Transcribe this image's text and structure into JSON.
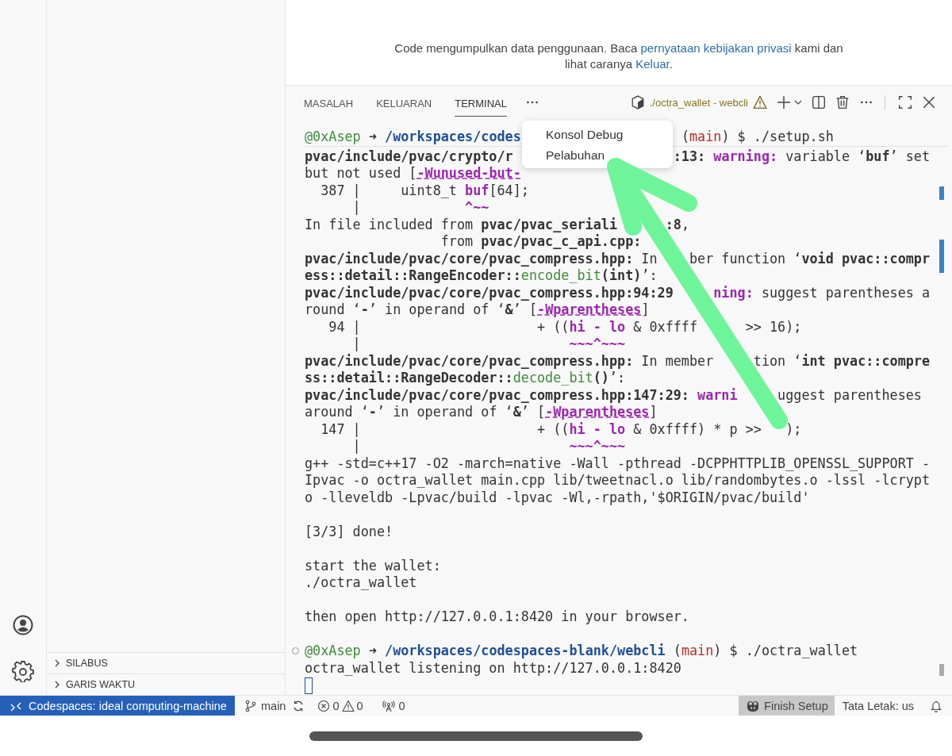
{
  "notice": {
    "before": "Code mengumpulkan data penggunaan. Baca",
    "link": "pernyataan kebijakan privasi",
    "middle": "kami dan lihat caranya",
    "link2": "Keluar",
    "after": "."
  },
  "sidebar": {
    "sections": [
      {
        "label": "SILABUS",
        "expanded": false
      },
      {
        "label": "GARIS WAKTU",
        "expanded": false
      }
    ]
  },
  "panel": {
    "tabs": [
      {
        "label": "MASALAH",
        "selected": false
      },
      {
        "label": "KELUARAN",
        "selected": false
      },
      {
        "label": "TERMINAL",
        "selected": true
      }
    ],
    "terminal_name": "./octra_wallet - webcli",
    "menu": [
      "Konsol Debug",
      "Pelabuhan"
    ],
    "lines": [
      {
        "kind": "text",
        "segments": [
          {
            "text": "@0xAsep",
            "kind": "green"
          },
          {
            "text": " ➜ ",
            "kind": "bold"
          },
          {
            "text": "/workspaces/codes",
            "kind": "blue"
          },
          {
            "text": "(",
            "kind": "plain"
          },
          {
            "text": "main",
            "kind": "red"
          },
          {
            "text": ") $ ./setup.sh",
            "kind": "plain"
          }
        ]
      },
      {
        "kind": "text",
        "segments": [
          {
            "text": "pvac/include/pvac/crypto/r",
            "kind": "bold"
          },
          {
            "text": ":13:",
            "kind": "bold"
          },
          {
            "text": " warning:",
            "kind": "purple"
          },
          {
            "text": " variable ‘",
            "kind": "plain"
          },
          {
            "text": "buf",
            "kind": "bold"
          },
          {
            "text": "’ set",
            "kind": "plain"
          }
        ]
      },
      {
        "kind": "text",
        "segments": [
          {
            "text": "but not used [",
            "kind": "plain"
          },
          {
            "text": "-Wunused-but-",
            "kind": "flag"
          }
        ]
      },
      {
        "kind": "text",
        "segments": [
          {
            "text": "  387 |     uint8_t ",
            "kind": "plain"
          },
          {
            "text": "buf",
            "kind": "purple"
          },
          {
            "text": "[64];",
            "kind": "plain"
          }
        ]
      },
      {
        "kind": "text",
        "segments": [
          {
            "text": "      |             ",
            "kind": "plain"
          },
          {
            "text": "^~~",
            "kind": "purple"
          }
        ]
      },
      {
        "kind": "text",
        "segments": [
          {
            "text": "In file included from ",
            "kind": "plain"
          },
          {
            "text": "pvac/pvac_seriali",
            "kind": "bold"
          },
          {
            "text": ":8",
            "kind": "bold"
          },
          {
            "text": ",",
            "kind": "plain"
          }
        ]
      },
      {
        "kind": "text",
        "segments": [
          {
            "text": "                 from ",
            "kind": "plain"
          },
          {
            "text": "pvac/pvac_c_api.cpp:",
            "kind": "bold"
          }
        ]
      },
      {
        "kind": "text",
        "segments": [
          {
            "text": "pvac/include/pvac/core/pvac_compress.hpp:",
            "kind": "bold"
          },
          {
            "text": " In",
            "kind": "plain"
          },
          {
            "text": "ber function ‘",
            "kind": "plain"
          },
          {
            "text": "void pvac::compr",
            "kind": "bold"
          }
        ]
      },
      {
        "kind": "text",
        "segments": [
          {
            "text": "ess::detail::RangeEncoder::",
            "kind": "bold"
          },
          {
            "text": "encode_bit",
            "kind": "green"
          },
          {
            "text": "(int)",
            "kind": "bold"
          },
          {
            "text": "’:",
            "kind": "plain"
          }
        ]
      },
      {
        "kind": "text",
        "segments": [
          {
            "text": "pvac/include/pvac/core/pvac_compress.hpp:94:29",
            "kind": "bold"
          },
          {
            "text": "ning:",
            "kind": "purple"
          },
          {
            "text": " suggest parentheses a",
            "kind": "plain"
          }
        ]
      },
      {
        "kind": "text",
        "segments": [
          {
            "text": "round ‘",
            "kind": "plain"
          },
          {
            "text": "-",
            "kind": "bold"
          },
          {
            "text": "’ in operand of ‘",
            "kind": "plain"
          },
          {
            "text": "&",
            "kind": "bold"
          },
          {
            "text": "’ [",
            "kind": "plain"
          },
          {
            "text": "-Wparentheses",
            "kind": "flag"
          },
          {
            "text": "]",
            "kind": "plain"
          }
        ]
      },
      {
        "kind": "text",
        "segments": [
          {
            "text": "   94 |                      + ((",
            "kind": "plain"
          },
          {
            "text": "hi - lo",
            "kind": "purple"
          },
          {
            "text": " & 0xffff",
            "kind": "plain"
          },
          {
            "text": " >> 16);",
            "kind": "plain"
          }
        ]
      },
      {
        "kind": "text",
        "segments": [
          {
            "text": "      |                          ",
            "kind": "plain"
          },
          {
            "text": "~~~^~~~",
            "kind": "purple"
          }
        ]
      },
      {
        "kind": "text",
        "segments": [
          {
            "text": "pvac/include/pvac/core/pvac_compress.hpp:",
            "kind": "bold"
          },
          {
            "text": " In member ",
            "kind": "plain"
          },
          {
            "text": "tion ‘",
            "kind": "plain"
          },
          {
            "text": "int pvac::compre",
            "kind": "bold"
          }
        ]
      },
      {
        "kind": "text",
        "segments": [
          {
            "text": "ss::detail::RangeDecoder::",
            "kind": "bold"
          },
          {
            "text": "decode_bit",
            "kind": "green"
          },
          {
            "text": "()",
            "kind": "bold"
          },
          {
            "text": "’:",
            "kind": "plain"
          }
        ]
      },
      {
        "kind": "text",
        "segments": [
          {
            "text": "pvac/include/pvac/core/pvac_compress.hpp:147:29:",
            "kind": "bold"
          },
          {
            "text": " warni",
            "kind": "purple"
          },
          {
            "text": "uggest parentheses",
            "kind": "plain"
          }
        ]
      },
      {
        "kind": "text",
        "segments": [
          {
            "text": "around ‘",
            "kind": "plain"
          },
          {
            "text": "-",
            "kind": "bold"
          },
          {
            "text": "’ in operand of ‘",
            "kind": "plain"
          },
          {
            "text": "&",
            "kind": "bold"
          },
          {
            "text": "’ [",
            "kind": "plain"
          },
          {
            "text": "-Wparentheses",
            "kind": "flag"
          },
          {
            "text": "]",
            "kind": "plain"
          }
        ]
      },
      {
        "kind": "text",
        "segments": [
          {
            "text": "  147 |                      + ((",
            "kind": "plain"
          },
          {
            "text": "hi - lo",
            "kind": "purple"
          },
          {
            "text": " & 0xffff) * p >>",
            "kind": "plain"
          },
          {
            "text": ");",
            "kind": "plain"
          }
        ]
      },
      {
        "kind": "text",
        "segments": [
          {
            "text": "      |                          ",
            "kind": "plain"
          },
          {
            "text": "~~~^~~~",
            "kind": "purple"
          }
        ]
      },
      {
        "kind": "text",
        "segments": [
          {
            "text": "g++ -std=c++17 -O2 -march=native -Wall -pthread -DCPPHTTPLIB_OPENSSL_SUPPORT -",
            "kind": "plain"
          }
        ]
      },
      {
        "kind": "text",
        "segments": [
          {
            "text": "Ipvac -o octra_wallet main.cpp lib/tweetnacl.o lib/randombytes.o -lssl -lcrypt",
            "kind": "plain"
          }
        ]
      },
      {
        "kind": "text",
        "segments": [
          {
            "text": "o -lleveldb -Lpvac/build -lpvac -Wl,-rpath,'$ORIGIN/pvac/build'",
            "kind": "plain"
          }
        ]
      },
      {
        "kind": "blank"
      },
      {
        "kind": "text",
        "segments": [
          {
            "text": "[3/3] done!",
            "kind": "plain"
          }
        ]
      },
      {
        "kind": "blank"
      },
      {
        "kind": "text",
        "segments": [
          {
            "text": "start the wallet:",
            "kind": "plain"
          }
        ]
      },
      {
        "kind": "text",
        "segments": [
          {
            "text": "./octra_wallet",
            "kind": "plain"
          }
        ]
      },
      {
        "kind": "blank"
      },
      {
        "kind": "text",
        "segments": [
          {
            "text": "then open http://127.0.0.1:8420 in your browser.",
            "kind": "plain"
          }
        ]
      },
      {
        "kind": "blank"
      },
      {
        "kind": "marked",
        "segments": [
          {
            "text": "@0xAsep",
            "kind": "green"
          },
          {
            "text": " ➜ ",
            "kind": "bold"
          },
          {
            "text": "/workspaces/codespaces-blank/webcli",
            "kind": "blue"
          },
          {
            "text": " (",
            "kind": "plain"
          },
          {
            "text": "main",
            "kind": "red"
          },
          {
            "text": ") $ ./octra_wallet",
            "kind": "plain"
          }
        ]
      },
      {
        "kind": "text",
        "segments": [
          {
            "text": "octra_wallet listening on http://127.0.0.1:8420",
            "kind": "plain"
          }
        ]
      },
      {
        "kind": "cursor"
      }
    ]
  },
  "status_bar": {
    "remote": "Codespaces: ideal computing-machine",
    "branch": "main",
    "errors": "0",
    "warnings": "0",
    "ports": "0",
    "finish_setup": "Finish Setup",
    "layout": "Tata Letak: us"
  }
}
